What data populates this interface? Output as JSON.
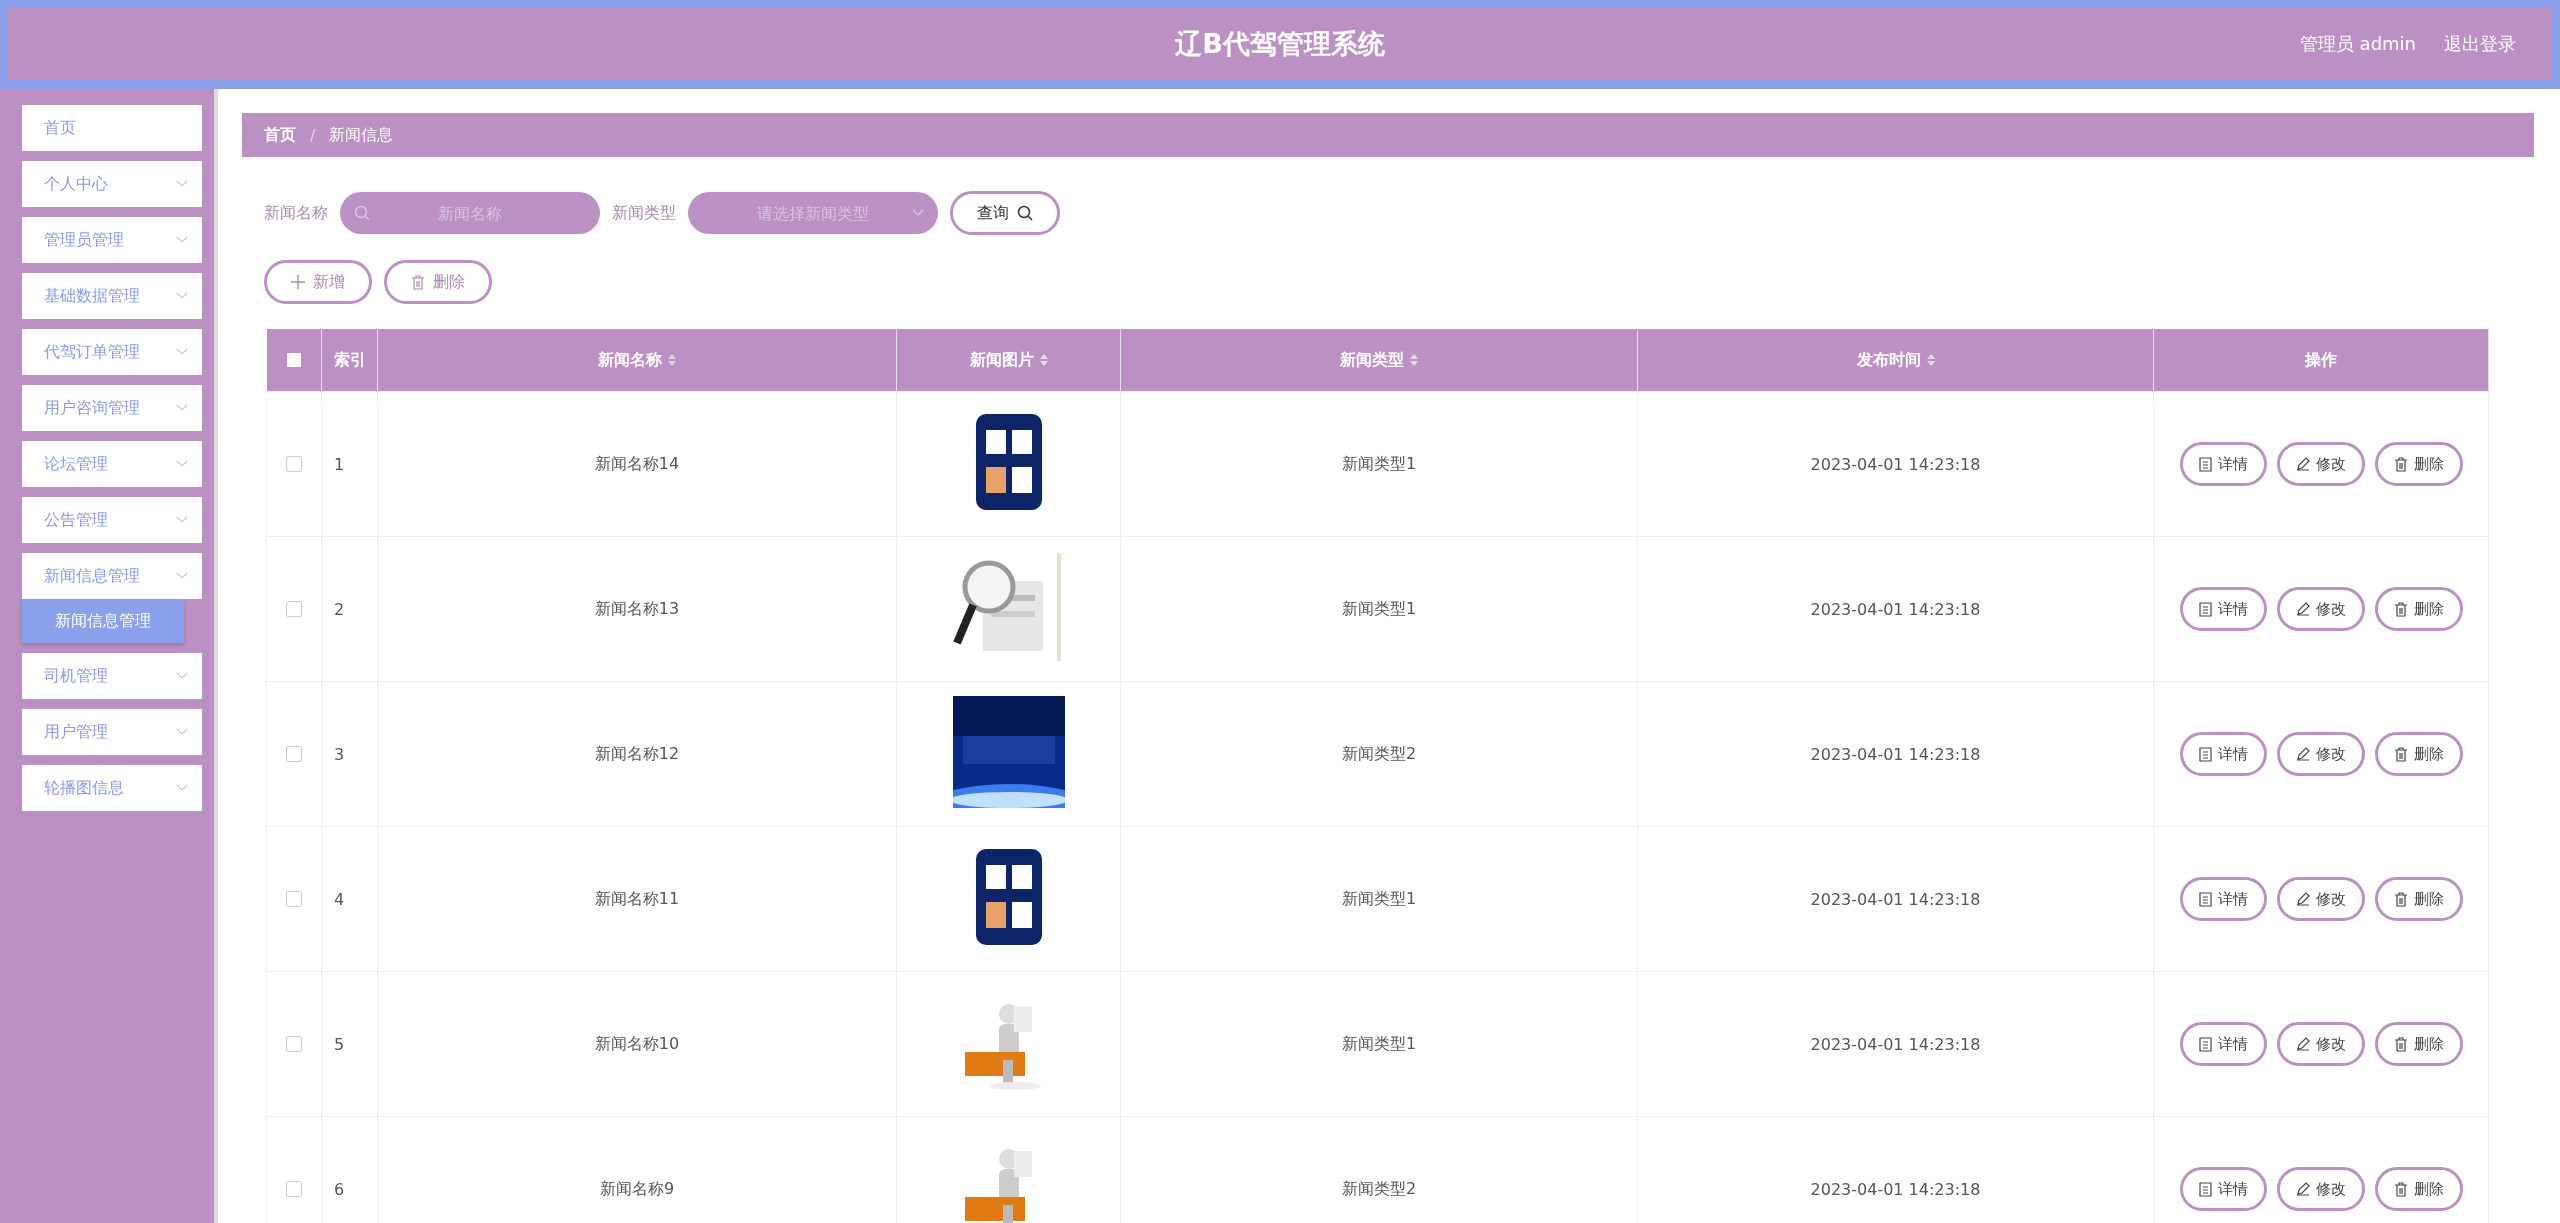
{
  "header": {
    "title": "辽B代驾管理系统",
    "user": "管理员 admin",
    "logout": "退出登录"
  },
  "sidebar": {
    "items": [
      {
        "label": "首页",
        "expandable": false
      },
      {
        "label": "个人中心",
        "expandable": true
      },
      {
        "label": "管理员管理",
        "expandable": true
      },
      {
        "label": "基础数据管理",
        "expandable": true
      },
      {
        "label": "代驾订单管理",
        "expandable": true
      },
      {
        "label": "用户咨询管理",
        "expandable": true
      },
      {
        "label": "论坛管理",
        "expandable": true
      },
      {
        "label": "公告管理",
        "expandable": true
      },
      {
        "label": "新闻信息管理",
        "expandable": true,
        "children": [
          {
            "label": "新闻信息管理",
            "selected": true
          }
        ]
      },
      {
        "label": "司机管理",
        "expandable": true
      },
      {
        "label": "用户管理",
        "expandable": true
      },
      {
        "label": "轮播图信息",
        "expandable": true
      }
    ]
  },
  "breadcrumb": {
    "separator": "/",
    "items": [
      "首页",
      "新闻信息"
    ]
  },
  "search": {
    "name_label": "新闻名称",
    "name_placeholder": "新闻名称",
    "type_label": "新闻类型",
    "type_placeholder": "请选择新闻类型",
    "query_button": "查询"
  },
  "actions": {
    "add": "新增",
    "delete": "删除"
  },
  "table": {
    "select_all_checked": false,
    "columns": [
      {
        "label": "索引",
        "sortable": false
      },
      {
        "label": "新闻名称",
        "sortable": true
      },
      {
        "label": "新闻图片",
        "sortable": true
      },
      {
        "label": "新闻类型",
        "sortable": true
      },
      {
        "label": "发布时间",
        "sortable": true
      },
      {
        "label": "操作",
        "sortable": false
      }
    ],
    "rows": [
      {
        "checked": false,
        "index": "1",
        "name": "新闻名称14",
        "type": "新闻类型1",
        "time": "2023-04-01 14:23:18",
        "actions": [
          "详情",
          "修改",
          "删除"
        ]
      },
      {
        "checked": false,
        "index": "2",
        "name": "新闻名称13",
        "type": "新闻类型1",
        "time": "2023-04-01 14:23:18",
        "actions": [
          "详情",
          "修改",
          "删除"
        ]
      },
      {
        "checked": false,
        "index": "3",
        "name": "新闻名称12",
        "type": "新闻类型2",
        "time": "2023-04-01 14:23:18",
        "actions": [
          "详情",
          "修改",
          "删除"
        ]
      },
      {
        "checked": false,
        "index": "4",
        "name": "新闻名称11",
        "type": "新闻类型1",
        "time": "2023-04-01 14:23:18",
        "actions": [
          "详情",
          "修改",
          "删除"
        ]
      },
      {
        "checked": false,
        "index": "5",
        "name": "新闻名称10",
        "type": "新闻类型1",
        "time": "2023-04-01 14:23:18",
        "actions": [
          "详情",
          "修改",
          "删除"
        ]
      },
      {
        "checked": false,
        "index": "6",
        "name": "新闻名称9",
        "type": "新闻类型2",
        "time": "2023-04-01 14:23:18",
        "actions": [
          "详情",
          "修改",
          "删除"
        ]
      }
    ]
  }
}
